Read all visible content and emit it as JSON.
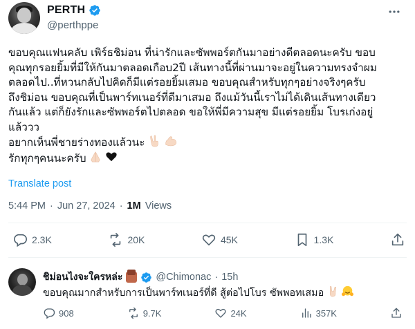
{
  "post": {
    "display_name": "PERTH",
    "handle": "@perthppe",
    "body_lines": [
      "ขอบคุณแฟนคลับ เพิร์ธชิม่อน ที่น่ารักและซัพพอร์ตกันมาอย่างดีตลอดนะครับ ขอบ",
      "คุณทุกรอยยิ้มที่มีให้กันมาตลอดเกือบ2ปี เส้นทางนี้ที่ผ่านมาจะอยู่ในความทรงจำผม",
      "ตลอดไป..ที่หวนกลับไปคิดก็มีแต่รอยยิ้มเสมอ ขอบคุณสำหรับทุกๆอย่างจริงๆครับ",
      "ถึงชิม่อน ขอบคุณที่เป็นพาร์ทเนอร์ที่ดีมาเสมอ ถึงแม้วันนี้เราไม่ได้เดินเส้นทางเดียว",
      "กันแล้ว แต่ก็ยังรักและซัพพอร์ตไปตลอด ขอให้พี่มีความสุข มีแต่รอยยิ้ม โบรเก่งอยู่",
      "แล้ววว",
      "อยากเห็นพี่ชายร่างทองแล้วนะ",
      "รักทุกๆคนนะครับ"
    ],
    "translate_label": "Translate post",
    "time": "5:44 PM",
    "separator": "·",
    "date": "Jun 27, 2024",
    "views_count": "1M",
    "views_label": "Views",
    "stats": {
      "replies": "2.3K",
      "reposts": "20K",
      "likes": "45K",
      "bookmarks": "1.3K"
    }
  },
  "reply": {
    "display_name": "ชิม่อนไงจะใครหล่ะ",
    "handle": "@Chimonac",
    "separator": "·",
    "age": "15h",
    "text": "ขอบคุณมากสำหรับการเป็นพาร์ทเนอร์ที่ดี สู้ต่อไปโบร ซัพพอทเสมอ",
    "stats": {
      "replies": "908",
      "reposts": "9.7K",
      "likes": "24K",
      "views": "357K"
    }
  },
  "icons": {
    "verified": "verified-badge-icon",
    "more": "more-horizontal-icon",
    "reply": "reply-icon",
    "repost": "repost-icon",
    "like": "heart-icon",
    "bookmark": "bookmark-icon",
    "share": "share-icon",
    "views": "views-chart-icon"
  },
  "colors": {
    "accent": "#1d9bf0",
    "text": "#0f1419",
    "secondary": "#536471",
    "divider": "#eff3f4"
  }
}
